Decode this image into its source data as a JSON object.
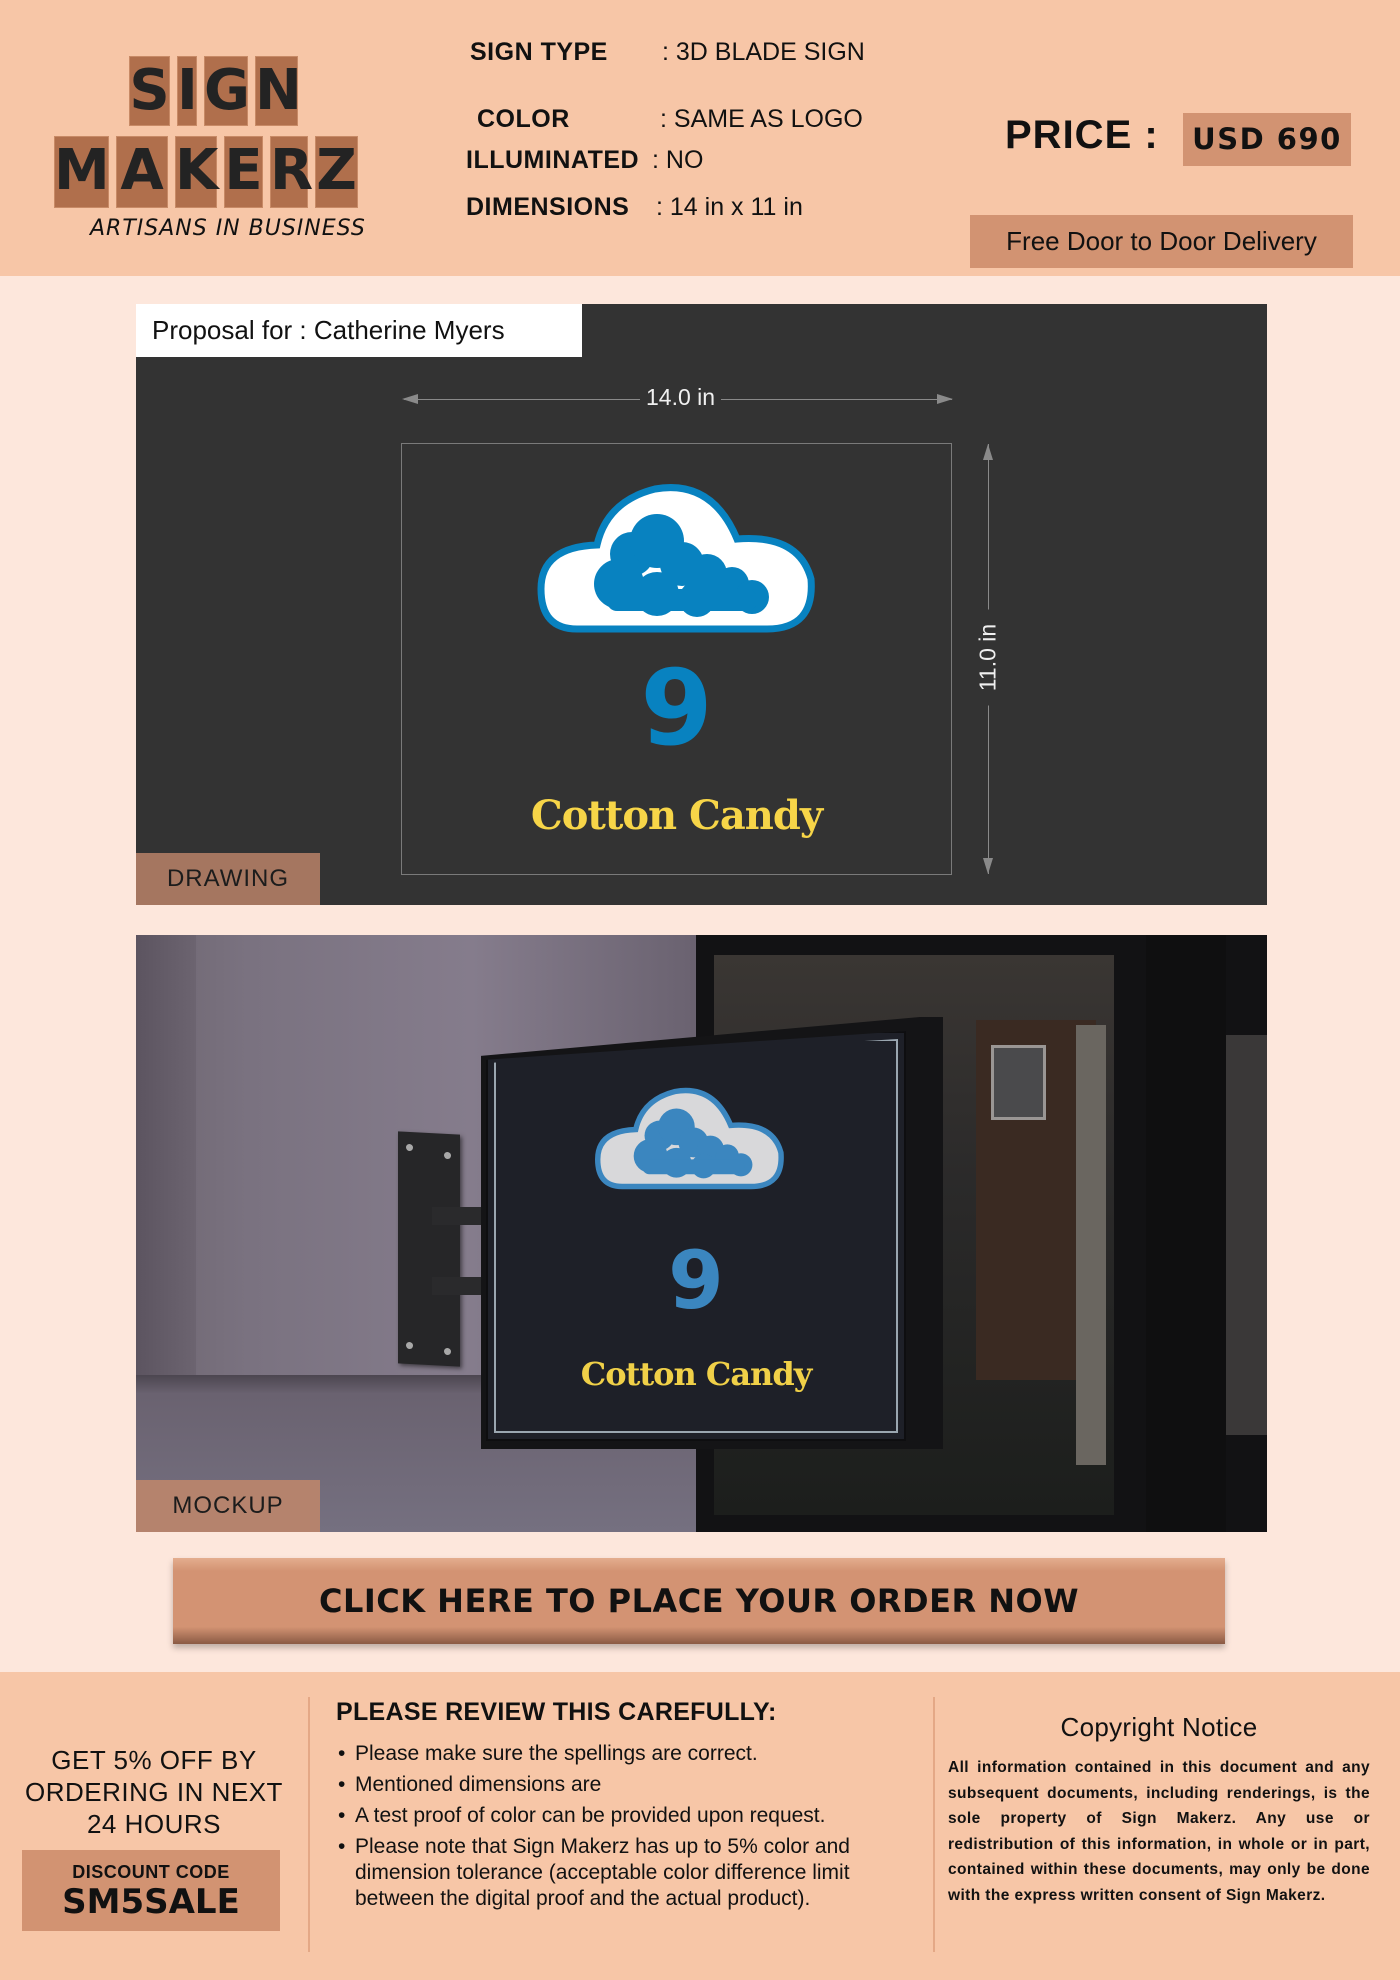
{
  "brand": {
    "logo_row1": [
      "S",
      "I",
      "G",
      "N"
    ],
    "logo_row2": [
      "M",
      "A",
      "K",
      "E",
      "R",
      "Z"
    ],
    "tagline": "ARTISANS IN BUSINESS",
    "tile_color": "#b06f4c"
  },
  "specs": {
    "sign_type": {
      "label": "SIGN TYPE",
      "value": ": 3D BLADE SIGN"
    },
    "color": {
      "label": "COLOR",
      "value": ":  SAME AS LOGO"
    },
    "illuminated": {
      "label": "ILLUMINATED",
      "value": ": NO"
    },
    "dimensions": {
      "label": "DIMENSIONS",
      "value": ": 14 in x 11 in"
    }
  },
  "price": {
    "label": "PRICE :",
    "value": "USD 690"
  },
  "delivery": "Free Door to Door Delivery",
  "drawing": {
    "proposal": "Proposal for : Catherine Myers",
    "width_label": "14.0 in",
    "height_label": "11.0 in",
    "sign_number": "9",
    "sign_name": "Cotton Candy",
    "tag": "DRAWING",
    "colors": {
      "logo_blue": "#0882c0",
      "name_yellow": "#f7d548",
      "background": "#333333"
    }
  },
  "mockup": {
    "sign_number": "9",
    "sign_name": "Cotton Candy",
    "tag": "MOCKUP"
  },
  "cta": {
    "label": "CLICK HERE TO PLACE YOUR ORDER NOW"
  },
  "footer": {
    "promo_lines": [
      "GET 5% OFF BY",
      "ORDERING IN NEXT",
      "24 HOURS"
    ],
    "discount_label": "DISCOUNT CODE",
    "discount_code": "SM5SALE",
    "review_title": "PLEASE REVIEW THIS CAREFULLY:",
    "review_items": [
      "Please make sure the spellings are correct.",
      "Mentioned dimensions are",
      "A test proof of color can be provided upon request.",
      "Please note that Sign Makerz has up to 5% color and dimension tolerance (acceptable color difference limit between the digital proof and the actual product)."
    ],
    "copyright_title": "Copyright Notice",
    "copyright_body": "All information contained in this document and any subsequent documents, including renderings, is the sole property of Sign Makerz. Any use or redistribution of this information, in whole or in part, contained within these documents, may only be done with the express written consent of Sign Makerz."
  },
  "theme": {
    "header_bg": "#f7c6a7",
    "page_bg": "#fde7dc",
    "accent": "#d29372"
  }
}
